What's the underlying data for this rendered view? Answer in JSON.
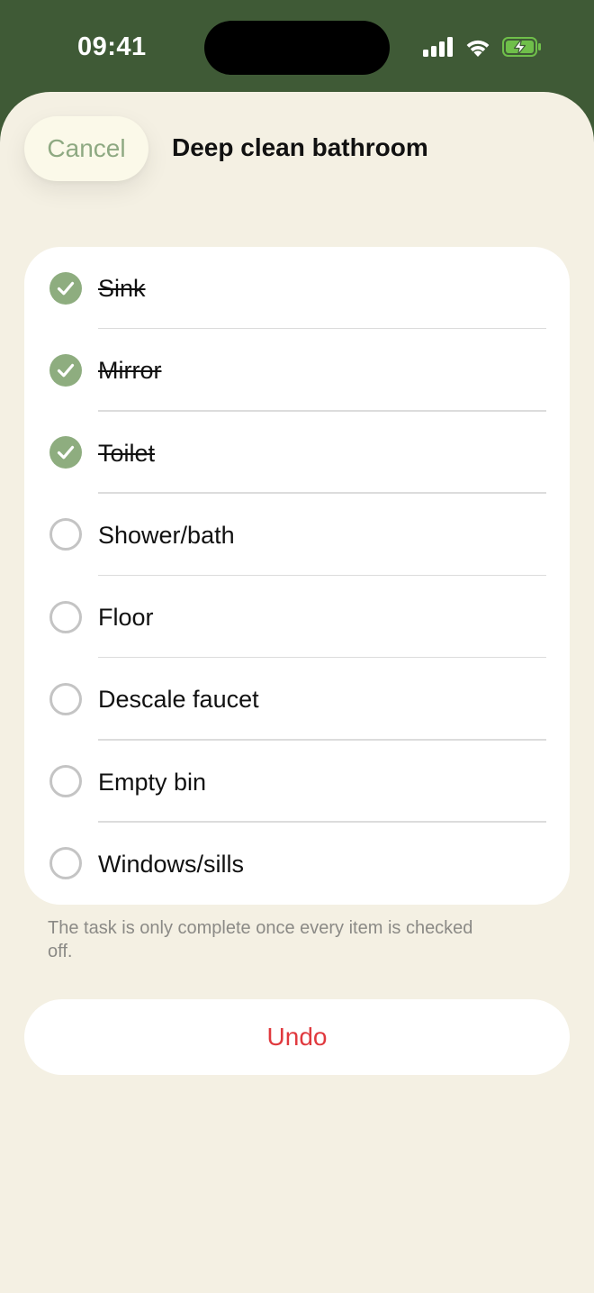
{
  "status_bar": {
    "time": "09:41",
    "icons": [
      "cellular-signal-icon",
      "wifi-icon",
      "battery-charging-icon"
    ]
  },
  "sheet": {
    "cancel_label": "Cancel",
    "title": "Deep clean bathroom"
  },
  "checklist": {
    "items": [
      {
        "label": "Sink",
        "checked": true
      },
      {
        "label": "Mirror",
        "checked": true
      },
      {
        "label": "Toilet",
        "checked": true
      },
      {
        "label": "Shower/bath",
        "checked": false
      },
      {
        "label": "Floor",
        "checked": false
      },
      {
        "label": "Descale faucet",
        "checked": false
      },
      {
        "label": "Empty bin",
        "checked": false
      },
      {
        "label": "Windows/sills",
        "checked": false
      }
    ],
    "footnote": "The task is only complete once every item is checked off."
  },
  "actions": {
    "undo_label": "Undo"
  },
  "colors": {
    "header_bg": "#3f5a36",
    "sheet_bg": "#f4f0e3",
    "accent_green": "#8ead7f",
    "undo_red": "#e0393e"
  }
}
